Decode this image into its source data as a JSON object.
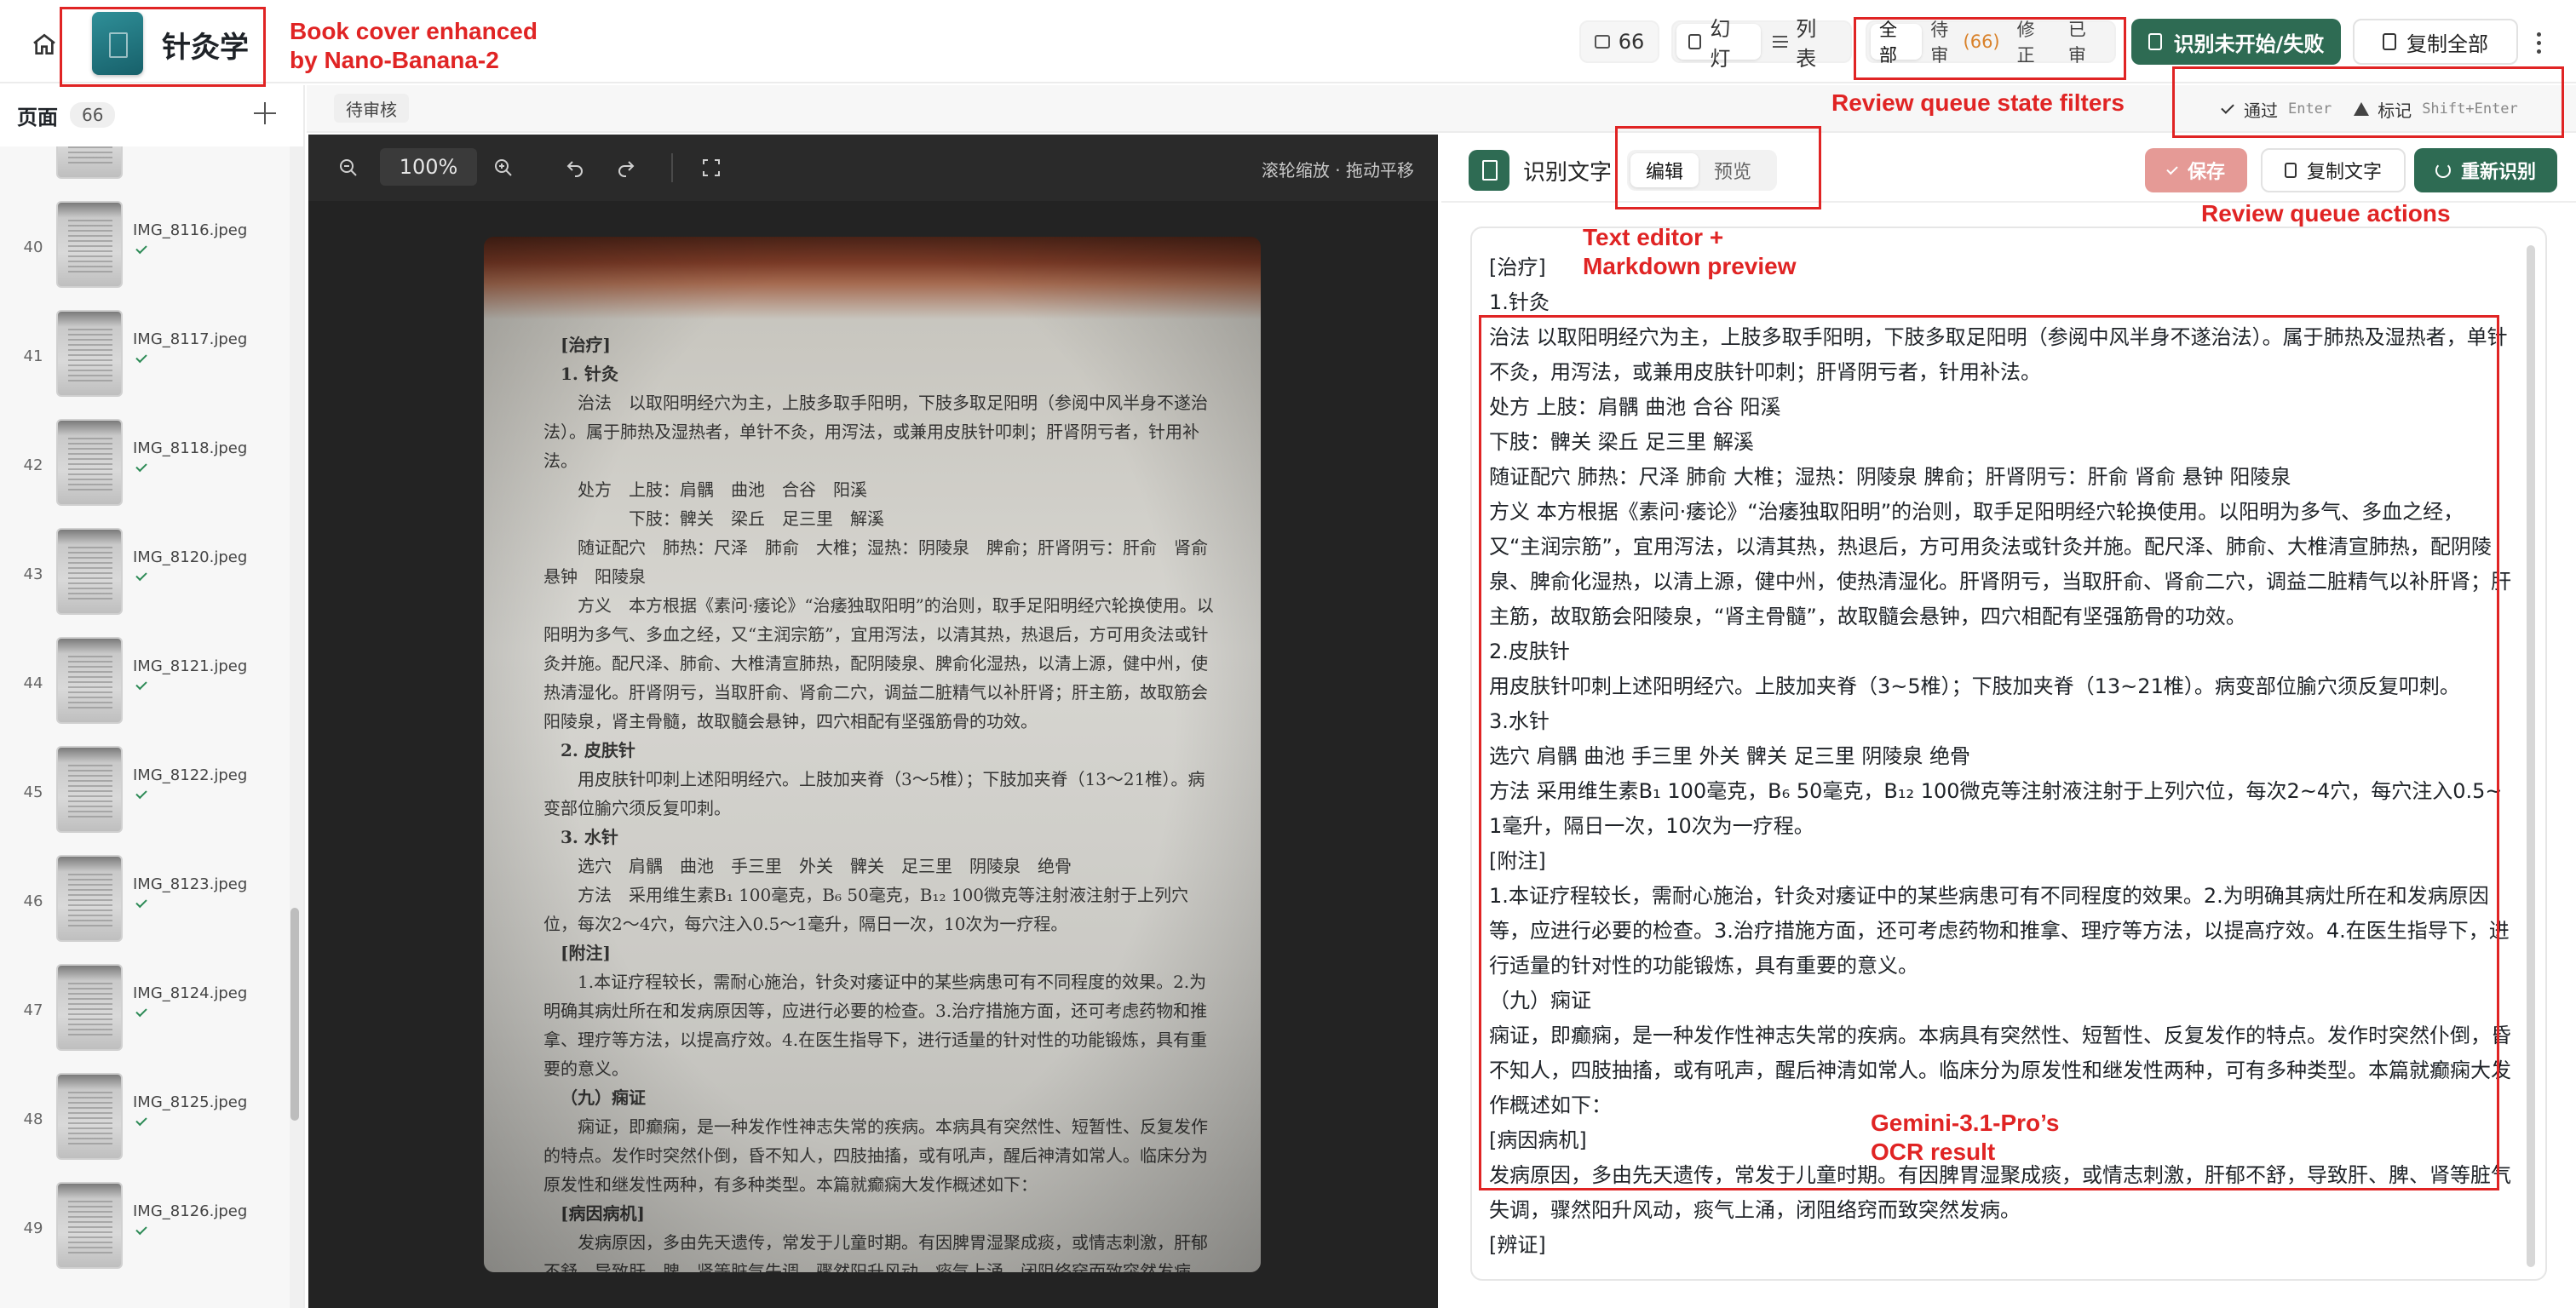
{
  "header": {
    "book_title": "针灸学",
    "image_count": "66",
    "view_slide": "幻灯",
    "view_list": "列表",
    "filters": [
      {
        "label": "全部",
        "count": ""
      },
      {
        "label": "待审",
        "count": "(66)"
      },
      {
        "label": "修正",
        "count": ""
      },
      {
        "label": "已审",
        "count": ""
      }
    ],
    "recognize_button": "识别未开始/失败",
    "copy_all_button": "复制全部"
  },
  "sidebar": {
    "title": "页面",
    "count": "66",
    "pages": [
      {
        "num": "",
        "file": ""
      },
      {
        "num": "40",
        "file": "IMG_8116.jpeg"
      },
      {
        "num": "41",
        "file": "IMG_8117.jpeg"
      },
      {
        "num": "42",
        "file": "IMG_8118.jpeg"
      },
      {
        "num": "43",
        "file": "IMG_8120.jpeg"
      },
      {
        "num": "44",
        "file": "IMG_8121.jpeg"
      },
      {
        "num": "45",
        "file": "IMG_8122.jpeg"
      },
      {
        "num": "46",
        "file": "IMG_8123.jpeg"
      },
      {
        "num": "47",
        "file": "IMG_8124.jpeg"
      },
      {
        "num": "48",
        "file": "IMG_8125.jpeg"
      },
      {
        "num": "49",
        "file": "IMG_8126.jpeg"
      }
    ]
  },
  "status_tab": "待审核",
  "review_actions": {
    "pass_label": "通过",
    "pass_key": "Enter",
    "flag_label": "标记",
    "flag_key": "Shift+Enter"
  },
  "viewer": {
    "zoom": "100%",
    "hint": "滚轮缩放 · 拖动平移"
  },
  "scan_text": [
    {
      "cls": "h",
      "text": "[治疗]"
    },
    {
      "cls": "h",
      "text": "1. 针灸"
    },
    {
      "cls": "",
      "text": "治法　以取阳明经穴为主，上肢多取手阳明，下肢多取足阳明（参阅中风半身不遂治法）。属于肺热及湿热者，单针不灸，用泻法，或兼用皮肤针叩刺；肝肾阴亏者，针用补法。"
    },
    {
      "cls": "",
      "text": "处方　上肢：肩髃　曲池　合谷　阳溪"
    },
    {
      "cls": "",
      "text": "　　　下肢：髀关　梁丘　足三里　解溪"
    },
    {
      "cls": "",
      "text": "随证配穴　肺热：尺泽　肺俞　大椎；湿热：阴陵泉　脾俞；肝肾阴亏：肝俞　肾俞　悬钟　阳陵泉"
    },
    {
      "cls": "",
      "text": "方义　本方根据《素问·痿论》“治痿独取阳明”的治则，取手足阳明经穴轮换使用。以阳明为多气、多血之经，又“主润宗筋”，宜用泻法，以清其热，热退后，方可用灸法或针灸并施。配尺泽、肺俞、大椎清宣肺热，配阴陵泉、脾俞化湿热，以清上源，健中州，使热清湿化。肝肾阴亏，当取肝俞、肾俞二穴，调益二脏精气以补肝肾；肝主筋，故取筋会阳陵泉，肾主骨髓，故取髓会悬钟，四穴相配有坚强筋骨的功效。"
    },
    {
      "cls": "h",
      "text": "2. 皮肤针"
    },
    {
      "cls": "",
      "text": "用皮肤针叩刺上述阳明经穴。上肢加夹脊（3～5椎）；下肢加夹脊（13～21椎）。病变部位腧穴须反复叩刺。"
    },
    {
      "cls": "h",
      "text": "3. 水针"
    },
    {
      "cls": "",
      "text": "选穴　肩髃　曲池　手三里　外关　髀关　足三里　阴陵泉　绝骨"
    },
    {
      "cls": "",
      "text": "方法　采用维生素B₁ 100毫克，B₆ 50毫克，B₁₂ 100微克等注射液注射于上列穴位，每次2～4穴，每穴注入0.5～1毫升，隔日一次，10次为一疗程。"
    },
    {
      "cls": "h",
      "text": "[附注]"
    },
    {
      "cls": "",
      "text": "1.本证疗程较长，需耐心施治，针灸对痿证中的某些病患可有不同程度的效果。2.为明确其病灶所在和发病原因等，应进行必要的检查。3.治疗措施方面，还可考虑药物和推拿、理疗等方法，以提高疗效。4.在医生指导下，进行适量的针对性的功能锻炼，具有重要的意义。"
    },
    {
      "cls": "h",
      "text": "（九）痫证"
    },
    {
      "cls": "",
      "text": "痫证，即癫痫，是一种发作性神志失常的疾病。本病具有突然性、短暂性、反复发作的特点。发作时突然仆倒，昏不知人，四肢抽搐，或有吼声，醒后神清如常人。临床分为原发性和继发性两种，有多种类型。本篇就癫痫大发作概述如下："
    },
    {
      "cls": "h",
      "text": "[病因病机]"
    },
    {
      "cls": "",
      "text": "发病原因，多由先天遗传，常发于儿童时期。有因脾胃湿聚成痰，或情志刺激，肝郁不舒，导致肝、脾、肾等脏气失调，骤然阳升风动，痰气上涌，闭阻络窍而致突然发病。"
    },
    {
      "cls": "h",
      "text": "[辨证]"
    }
  ],
  "ocr_panel": {
    "title": "识别文字",
    "tab_edit": "编辑",
    "tab_preview": "预览",
    "save_button": "保存",
    "copy_button": "复制文字",
    "rerun_button": "重新识别",
    "text": "[治疗]\n1.针灸\n治法 以取阳明经穴为主，上肢多取手阳明，下肢多取足阳明（参阅中风半身不遂治法）。属于肺热及湿热者，单针不灸，用泻法，或兼用皮肤针叩刺；肝肾阴亏者，针用补法。\n处方 上肢：肩髃 曲池 合谷 阳溪\n下肢：髀关 梁丘 足三里 解溪\n随证配穴 肺热：尺泽 肺俞 大椎；湿热：阴陵泉 脾俞；肝肾阴亏：肝俞 肾俞 悬钟 阳陵泉\n方义 本方根据《素问·痿论》“治痿独取阳明”的治则，取手足阳明经穴轮换使用。以阳明为多气、多血之经，又“主润宗筋”，宜用泻法，以清其热，热退后，方可用灸法或针灸并施。配尺泽、肺俞、大椎清宣肺热，配阴陵泉、脾俞化湿热，以清上源，健中州，使热清湿化。肝肾阴亏，当取肝俞、肾俞二穴，调益二脏精气以补肝肾；肝主筋，故取筋会阳陵泉，“肾主骨髓”，故取髓会悬钟，四穴相配有坚强筋骨的功效。\n2.皮肤针\n用皮肤针叩刺上述阳明经穴。上肢加夹脊（3~5椎）；下肢加夹脊（13~21椎）。病变部位腧穴须反复叩刺。\n3.水针\n选穴 肩髃 曲池 手三里 外关 髀关 足三里 阴陵泉 绝骨\n方法 采用维生素B₁ 100毫克，B₆ 50毫克，B₁₂ 100微克等注射液注射于上列穴位，每次2~4穴，每穴注入0.5~1毫升，隔日一次，10次为一疗程。\n[附注]\n1.本证疗程较长，需耐心施治，针灸对痿证中的某些病患可有不同程度的效果。2.为明确其病灶所在和发病原因等，应进行必要的检查。3.治疗措施方面，还可考虑药物和推拿、理疗等方法，以提高疗效。4.在医生指导下，进行适量的针对性的功能锻炼，具有重要的意义。\n（九）痫证\n痫证，即癫痫，是一种发作性神志失常的疾病。本病具有突然性、短暂性、反复发作的特点。发作时突然仆倒，昏不知人，四肢抽搐，或有吼声，醒后神清如常人。临床分为原发性和继发性两种，可有多种类型。本篇就癫痫大发作概述如下：\n[病因病机]\n发病原因，多由先天遗传，常发于儿童时期。有因脾胃湿聚成痰，或情志刺激，肝郁不舒，导致肝、脾、肾等脏气失调，骤然阳升风动，痰气上涌，闭阻络窍而致突然发病。\n[辨证]"
  },
  "annotations": {
    "cover": "Book cover enhanced\nby Nano-Banana-2",
    "filters": "Review queue state filters",
    "editor": "Text editor +\nMarkdown preview",
    "actions": "Review queue actions",
    "ocr": "Gemini-3.1-Pro’s\nOCR result"
  },
  "colors": {
    "accent_green": "#2e6b53",
    "save_disabled": "#e59a96",
    "annotation_red": "#e02424",
    "pending_orange": "#d9822b"
  }
}
